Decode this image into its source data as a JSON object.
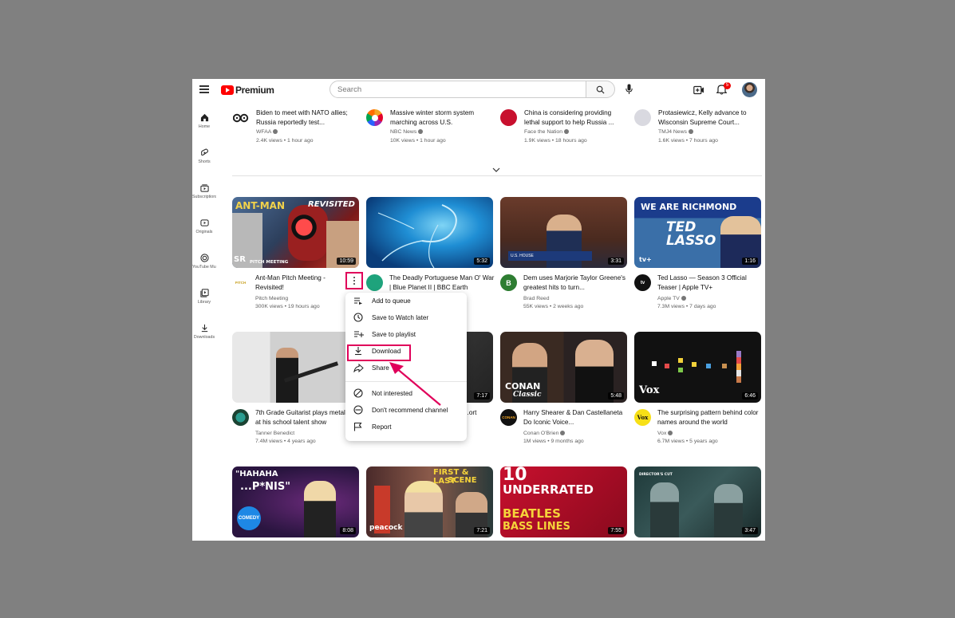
{
  "header": {
    "logo_text": "Premium",
    "search_placeholder": "Search",
    "notification_count": "5"
  },
  "sidebar": {
    "items": [
      {
        "label": "Home",
        "icon": "home-icon"
      },
      {
        "label": "Shorts",
        "icon": "shorts-icon"
      },
      {
        "label": "Subscriptions",
        "icon": "subscriptions-icon"
      },
      {
        "label": "Originals",
        "icon": "originals-icon"
      },
      {
        "label": "YouTube Mu...",
        "icon": "music-icon"
      },
      {
        "label": "Library",
        "icon": "library-icon"
      },
      {
        "label": "Downloads",
        "icon": "downloads-icon"
      }
    ]
  },
  "news": [
    {
      "title": "Biden to meet with NATO allies; Russia reportedly test...",
      "channel": "WFAA",
      "meta": "2.4K views • 1 hour ago",
      "logo": "8"
    },
    {
      "title": "Massive winter storm system marching across U.S.",
      "channel": "NBC News",
      "meta": "10K views • 1 hour ago",
      "logo": "NBC"
    },
    {
      "title": "China is considering providing lethal support to help Russia ...",
      "channel": "Face the Nation",
      "meta": "1.9K views • 18 hours ago",
      "logo": "FACE THE NATION"
    },
    {
      "title": "Protasiewicz, Kelly advance to Wisconsin Supreme Court...",
      "channel": "TMJ4 News",
      "meta": "1.6K views • 7 hours ago",
      "logo": "TMJ4"
    }
  ],
  "videos": [
    {
      "title": "Ant-Man Pitch Meeting - Revisited!",
      "channel": "Pitch Meeting",
      "meta": "300K views • 19 hours ago",
      "duration": "10:59",
      "thumb_text": "ANT-MAN",
      "thumb_text2": "REVISITED",
      "thumb_text3": "PITCH MEETING",
      "thumb_text4": "SR",
      "avatar": "PITCH"
    },
    {
      "title": "The Deadly Portuguese Man O' War | Blue Planet II | BBC Earth",
      "channel": "",
      "meta": "",
      "duration": "5:32",
      "avatar": ""
    },
    {
      "title": "Dem uses Marjorie Taylor Greene's greatest hits to turn...",
      "channel": "Brad Reed",
      "meta": "55K views • 2 weeks ago",
      "duration": "3:31",
      "thumb_text": "U.S. HOUSE",
      "avatar": "B"
    },
    {
      "title": "Ted Lasso — Season 3 Official Teaser | Apple TV+",
      "channel": "Apple TV",
      "meta": "7.3M views • 7 days ago",
      "duration": "1:16",
      "thumb_text": "TED LASSO",
      "thumb_text2": "WE ARE RICHMOND",
      "thumb_text3": "tv+",
      "avatar": "tv"
    },
    {
      "title": "7th Grade Guitarist plays metal at his school talent show",
      "channel": "Tanner Benedict",
      "meta": "7.4M views • 4 years ago",
      "duration": "",
      "avatar": ""
    },
    {
      "title": "...ort",
      "channel": "",
      "meta": "",
      "duration": "7:17",
      "avatar": ""
    },
    {
      "title": "Harry Shearer & Dan Castellaneta Do Iconic Voice...",
      "channel": "Conan O'Brien",
      "meta": "1M views • 9 months ago",
      "duration": "5:48",
      "thumb_text": "CONAN",
      "thumb_text2": "Classic",
      "avatar": "CONAN"
    },
    {
      "title": "The surprising pattern behind color names around the world",
      "channel": "Vox",
      "meta": "6.7M views • 5 years ago",
      "duration": "6:46",
      "thumb_text": "Vox",
      "avatar": "Vox"
    },
    {
      "title": "",
      "duration": "8:08",
      "thumb_text": "\"HAHAHA",
      "thumb_text2": "...P*NIS\"",
      "thumb_text3": "COMEDY"
    },
    {
      "title": "",
      "duration": "7:21",
      "thumb_text": "FIRST & LAST",
      "thumb_text2": "SCENE",
      "thumb_text3": "peacock"
    },
    {
      "title": "",
      "duration": "7:55",
      "thumb_text": "10",
      "thumb_text2": "UNDERRATED",
      "thumb_text3": "BEATLES",
      "thumb_text4": "BASS LINES"
    },
    {
      "title": "",
      "duration": "3:47",
      "thumb_text": "DIRECTOR'S CUT"
    }
  ],
  "context_menu": {
    "items": [
      "Add to queue",
      "Save to Watch later",
      "Save to playlist",
      "Download",
      "Share",
      "Not interested",
      "Don't recommend channel",
      "Report"
    ]
  },
  "colors": {
    "highlight": "#e0005a",
    "brand_red": "#ff0000",
    "backdrop": "#808080"
  }
}
